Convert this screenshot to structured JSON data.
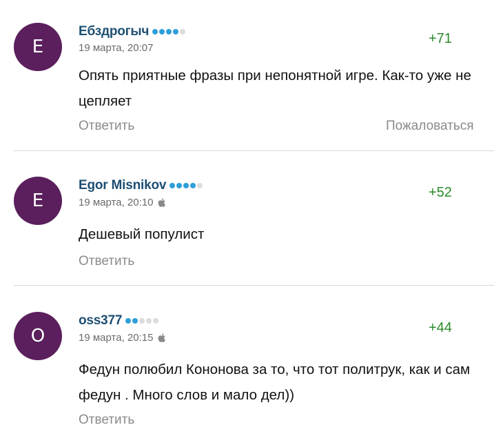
{
  "comments": [
    {
      "author": "Ебздрогыч",
      "avatar_letter": "Е",
      "rating_dots_filled": 4,
      "rating_dots_total": 5,
      "date": "19 марта, 20:07",
      "device_icon": "",
      "score": "+71",
      "text": "Опять приятные фразы при непонятной игре. Как-то уже не цепляет",
      "reply_label": "Ответить",
      "report_label": "Пожаловаться"
    },
    {
      "author": "Egor Misnikov",
      "avatar_letter": "E",
      "rating_dots_filled": 4,
      "rating_dots_total": 5,
      "date": "19 марта, 20:10",
      "device_icon": "apple-icon",
      "score": "+52",
      "text": "Дешевый популист",
      "reply_label": "Ответить"
    },
    {
      "author": "oss377",
      "avatar_letter": "O",
      "rating_dots_filled": 2,
      "rating_dots_total": 5,
      "date": "19 марта, 20:15",
      "device_icon": "apple-icon",
      "score": "+44",
      "text": "Федун полюбил Кононова за то, что тот политрук, как и сам федун . Много слов и мало дел))",
      "reply_label": "Ответить"
    }
  ],
  "colors": {
    "avatar_bg": "#5a1f5c",
    "author": "#1e4f73",
    "score_positive": "#2b8a2b",
    "dot_on": "#2d9fd9",
    "dot_off": "#dcdcdc",
    "muted": "#8a8a8a"
  }
}
